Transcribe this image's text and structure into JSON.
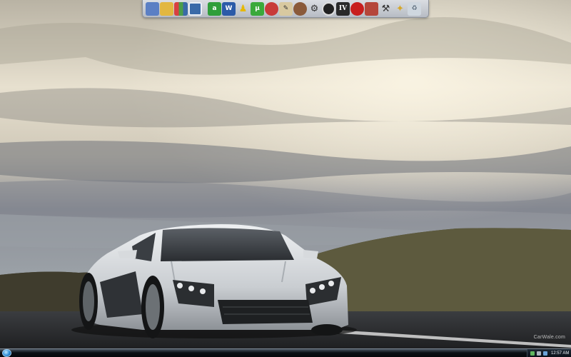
{
  "wallpaper": {
    "watermark": "CarWale.com"
  },
  "dock": {
    "icons": [
      {
        "name": "computer-icon",
        "label": "",
        "color": "#5b7fc4"
      },
      {
        "name": "folder-icon",
        "label": "",
        "color": "#e2b740"
      },
      {
        "name": "bookshelf-icon",
        "label": "",
        "color": "#4c9d4a"
      },
      {
        "name": "display-settings-icon",
        "label": "",
        "color": "#3a6aa8"
      },
      {
        "name": "green-app-icon",
        "label": "a",
        "color": "#2f9e3a"
      },
      {
        "name": "word-icon",
        "label": "W",
        "color": "#2b5aa8"
      },
      {
        "name": "aim-icon",
        "label": "",
        "color": "#f4c400"
      },
      {
        "name": "utorrent-icon",
        "label": "µ",
        "color": "#3aa93a"
      },
      {
        "name": "red-round-app-icon",
        "label": "",
        "color": "#c83a3a"
      },
      {
        "name": "notepad-icon",
        "label": "",
        "color": "#d8c9a0"
      },
      {
        "name": "person-icon",
        "label": "",
        "color": "#8a5a3a"
      },
      {
        "name": "game-icon",
        "label": "",
        "color": "#555555"
      },
      {
        "name": "counter-strike-icon",
        "label": "",
        "color": "#222222"
      },
      {
        "name": "gta-iv-icon",
        "label": "IV",
        "color": "#2a2a2a"
      },
      {
        "name": "stop-sign-icon",
        "label": "",
        "color": "#c81e1e"
      },
      {
        "name": "ultraiso-icon",
        "label": "",
        "color": "#b5463a"
      },
      {
        "name": "tools-icon",
        "label": "",
        "color": "#6b6b6b"
      },
      {
        "name": "magic-wand-icon",
        "label": "",
        "color": "#d6a728"
      },
      {
        "name": "recycle-bin-icon",
        "label": "",
        "color": "#cfd7df"
      }
    ]
  },
  "taskbar": {
    "clock": "12:57 AM"
  }
}
